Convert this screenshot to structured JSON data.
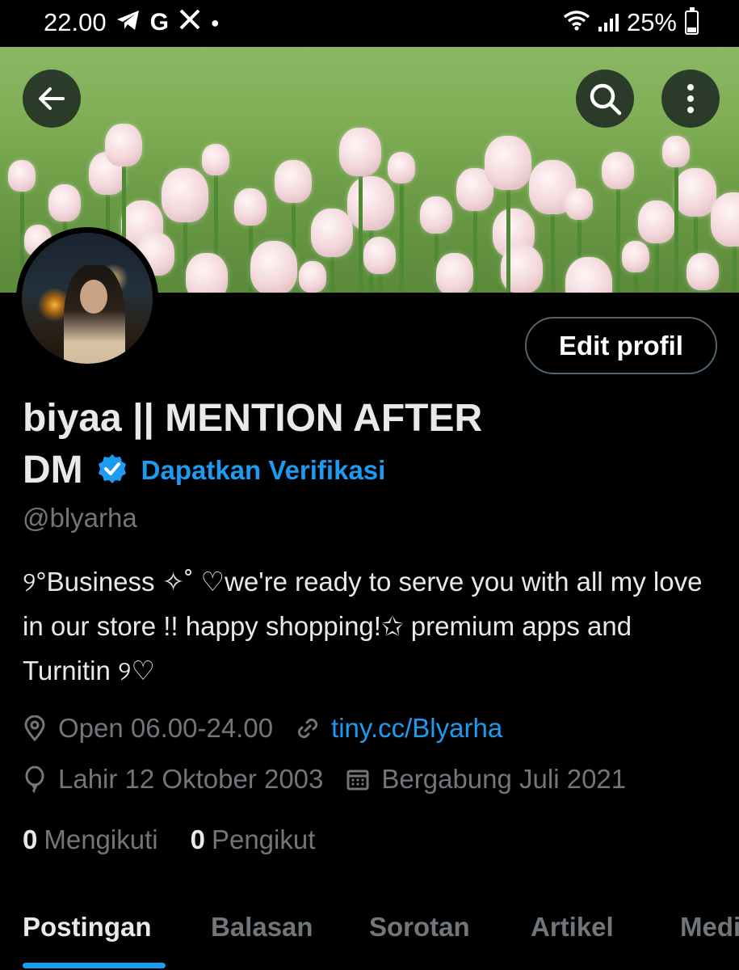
{
  "status_bar": {
    "time": "22.00",
    "notif_icons": [
      "telegram-icon",
      "google-icon",
      "x-icon"
    ],
    "battery": "25%"
  },
  "header": {
    "back_icon": "arrow-left-icon",
    "search_icon": "search-icon",
    "more_icon": "more-vertical-icon"
  },
  "profile": {
    "edit_button": "Edit profil",
    "name_line1": "biyaa || MENTION AFTER",
    "name_line2": "DM",
    "verify_link": "Dapatkan Verifikasi",
    "handle": "@blyarha",
    "bio": "୨°Business ✧˚ ♡we're ready to serve you with all my love in our store !! happy shopping!✩ premium apps and Turnitin ୨♡",
    "location": "Open 06.00-24.00",
    "website": "tiny.cc/Blyarha",
    "birthday": "Lahir 12 Oktober 2003",
    "joined": "Bergabung Juli 2021",
    "following_count": "0",
    "following_label": "Mengikuti",
    "followers_count": "0",
    "followers_label": "Pengikut"
  },
  "tabs": [
    {
      "label": "Postingan",
      "active": true
    },
    {
      "label": "Balasan",
      "active": false
    },
    {
      "label": "Sorotan",
      "active": false
    },
    {
      "label": "Artikel",
      "active": false
    },
    {
      "label": "Media",
      "active": false
    }
  ],
  "colors": {
    "background": "#000000",
    "accent": "#1d9bf0",
    "text_primary": "#e7e9ea",
    "text_secondary": "#71767b",
    "button_border": "#536471"
  }
}
